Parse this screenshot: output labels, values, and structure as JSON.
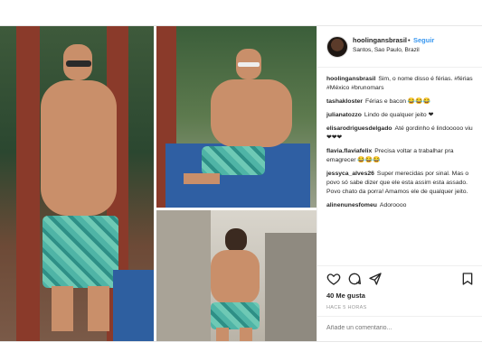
{
  "post": {
    "username": "hoolingansbrasil",
    "separator": "•",
    "follow_label": "Seguir",
    "location": "Santos, Sao Paulo, Brazil",
    "comments": [
      {
        "user": "hoolingansbrasil",
        "text": "Sim, o nome disso é férias. #férias #México #brunomars"
      },
      {
        "user": "tashakloster",
        "text": "Férias e bacon 😂😂😂"
      },
      {
        "user": "julianatozzo",
        "text": "Lindo de qualquer jeito ❤"
      },
      {
        "user": "elisarodriguesdelgado",
        "text": "Até gordinho é lindooooo viu ❤❤❤"
      },
      {
        "user": "flavia.flaviafelix",
        "text": "Precisa voltar a trabalhar pra emagrecer 😂😂😂"
      },
      {
        "user": "jessyca_alves26",
        "text": "Super merecidas por sinal. Mas o povo só sabe dizer que ele esta assim esta assado. Povo chato da porra! Amamos ele de qualquer jeito."
      },
      {
        "user": "alinenunesfomeu",
        "text": "Adoroooo"
      }
    ],
    "likes": "40 Me gusta",
    "time": "HACE 5 HORAS",
    "add_comment_placeholder": "Añade un comentario..."
  },
  "icons": {
    "like": "heart-icon",
    "comment": "comment-icon",
    "share": "share-icon",
    "save": "bookmark-icon"
  }
}
